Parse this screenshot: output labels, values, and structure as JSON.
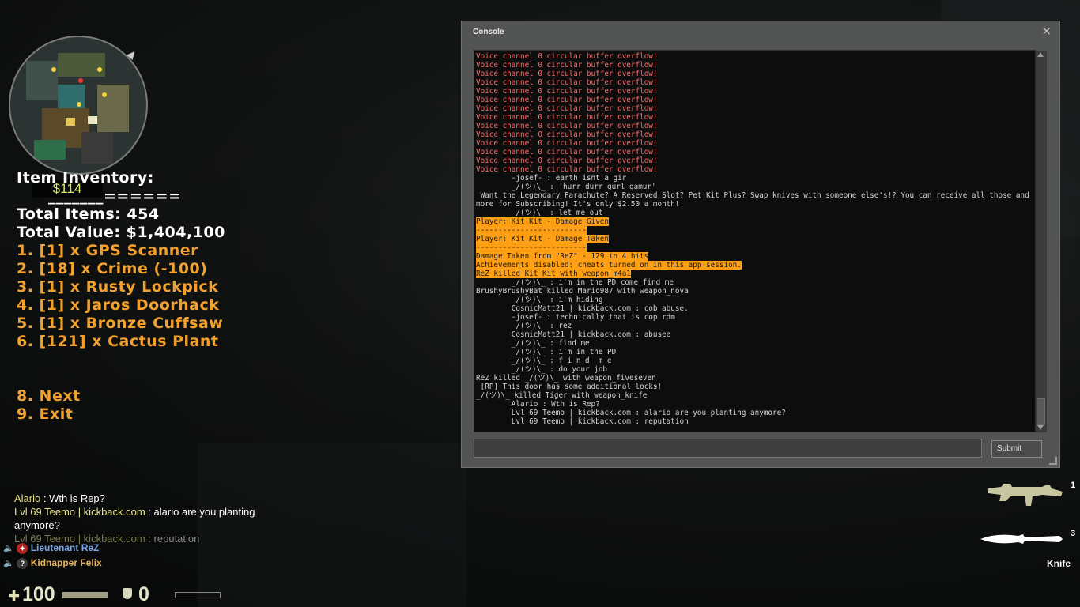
{
  "hud": {
    "money": "$114",
    "health": "100",
    "armor": "0"
  },
  "inventory": {
    "title": "Item Inventory:",
    "divider": "_______======",
    "total_items": "Total Items: 454",
    "total_value": "Total Value: $1,404,100",
    "items": [
      "1. [1] x GPS Scanner",
      "2. [18] x Crime (-100)",
      "3. [1] x Rusty Lockpick",
      "4. [1] x Jaros Doorhack",
      "5. [1] x Bronze Cuffsaw",
      "6. [121] x Cactus Plant"
    ],
    "next": "8. Next",
    "exit": "9. Exit"
  },
  "console": {
    "title": "Console",
    "close_glyph": "×",
    "submit_label": "Submit",
    "input_value": "",
    "lines": [
      {
        "text": "Voice channel 0 circular buffer overflow!",
        "style": "red"
      },
      {
        "text": "Voice channel 0 circular buffer overflow!",
        "style": "red"
      },
      {
        "text": "Voice channel 0 circular buffer overflow!",
        "style": "red"
      },
      {
        "text": "Voice channel 0 circular buffer overflow!",
        "style": "red"
      },
      {
        "text": "Voice channel 0 circular buffer overflow!",
        "style": "red"
      },
      {
        "text": "Voice channel 0 circular buffer overflow!",
        "style": "red"
      },
      {
        "text": "Voice channel 0 circular buffer overflow!",
        "style": "red"
      },
      {
        "text": "Voice channel 0 circular buffer overflow!",
        "style": "red"
      },
      {
        "text": "Voice channel 0 circular buffer overflow!",
        "style": "red"
      },
      {
        "text": "Voice channel 0 circular buffer overflow!",
        "style": "red"
      },
      {
        "text": "Voice channel 0 circular buffer overflow!",
        "style": "red"
      },
      {
        "text": "Voice channel 0 circular buffer overflow!",
        "style": "red"
      },
      {
        "text": "Voice channel 0 circular buffer overflow!",
        "style": "red"
      },
      {
        "text": "Voice channel 0 circular buffer overflow!",
        "style": "red"
      },
      {
        "text": "        -josef- : earth isnt a gir",
        "style": "normal"
      },
      {
        "text": "        _/(ツ)\\_ : 'hurr durr gurl gamur'",
        "style": "normal"
      },
      {
        "text": " Want the Legendary Parachute? A Reserved Slot? Pet Kit Plus? Swap knives with someone else's!? You can receive all those and more for Subscribing! It's only $2.50 a month!",
        "style": "normal"
      },
      {
        "text": "        _/(ツ)\\_ : let me out",
        "style": "normal"
      },
      {
        "text": "Player: Kit Kit - Damage Given",
        "style": "hl"
      },
      {
        "text": "-------------------------",
        "style": "hl"
      },
      {
        "text": "Player: Kit Kit - Damage Taken",
        "style": "hl"
      },
      {
        "text": "-------------------------",
        "style": "hl"
      },
      {
        "text": "Damage Taken from \"ReZ\" - 129 in 4 hits",
        "style": "hl"
      },
      {
        "text": "Achievements disabled: cheats turned on in this app session.",
        "style": "hl"
      },
      {
        "text": "ReZ killed Kit Kit with weapon_m4a1",
        "style": "hl"
      },
      {
        "text": "        _/(ツ)\\_ : i'm in the PD come find me",
        "style": "normal"
      },
      {
        "text": "BrushyBrushyBat killed Mario987 with weapon_nova",
        "style": "normal"
      },
      {
        "text": "        _/(ツ)\\_ : i'm hiding",
        "style": "normal"
      },
      {
        "text": "        CosmicMatt21 | kickback.com : cob abuse.",
        "style": "normal"
      },
      {
        "text": "        -josef- : technically that is cop rdm",
        "style": "normal"
      },
      {
        "text": "        _/(ツ)\\_ : rez",
        "style": "normal"
      },
      {
        "text": "        CosmicMatt21 | kickback.com : abusee",
        "style": "normal"
      },
      {
        "text": "        _/(ツ)\\_ : find me",
        "style": "normal"
      },
      {
        "text": "        _/(ツ)\\_ : i'm in the PD",
        "style": "normal"
      },
      {
        "text": "        _/(ツ)\\_ : f i n d  m e",
        "style": "normal"
      },
      {
        "text": "        _/(ツ)\\_ : do your job",
        "style": "normal"
      },
      {
        "text": "ReZ killed _/(ツ)\\_ with weapon_fiveseven",
        "style": "normal"
      },
      {
        "text": " [RP] This door has some additional locks!",
        "style": "normal"
      },
      {
        "text": "_/(ツ)\\_ killed Tiger with weapon_knife",
        "style": "normal"
      },
      {
        "text": "        Alario : Wth is Rep?",
        "style": "normal"
      },
      {
        "text": "        Lvl 69 Teemo | kickback.com : alario are you planting anymore?",
        "style": "normal"
      },
      {
        "text": "        Lvl 69 Teemo | kickback.com : reputation",
        "style": "normal"
      }
    ]
  },
  "chat": [
    {
      "name": "Alario",
      "msg": " : Wth is Rep?",
      "faded": false
    },
    {
      "name": "Lvl 69 Teemo | kickback.com",
      "msg": " : alario are you planting anymore?",
      "faded": false
    },
    {
      "name": "Lvl 69 Teemo | kickback.com",
      "msg": " : reputation",
      "faded": true
    }
  ],
  "voice": [
    {
      "name": "Lieutenant ReZ",
      "color": "#7aa6e8",
      "badge": "red"
    },
    {
      "name": "Kidnapper Felix",
      "color": "#e8b45c",
      "badge": "?"
    }
  ],
  "weapons": {
    "slot1": "1",
    "slot3": "3",
    "active_name": "Knife"
  },
  "colors": {
    "accent_orange": "#f2a02e",
    "console_highlight": "#ff9f14",
    "console_error": "#ff6c6c",
    "money_green": "#d8e96a"
  }
}
